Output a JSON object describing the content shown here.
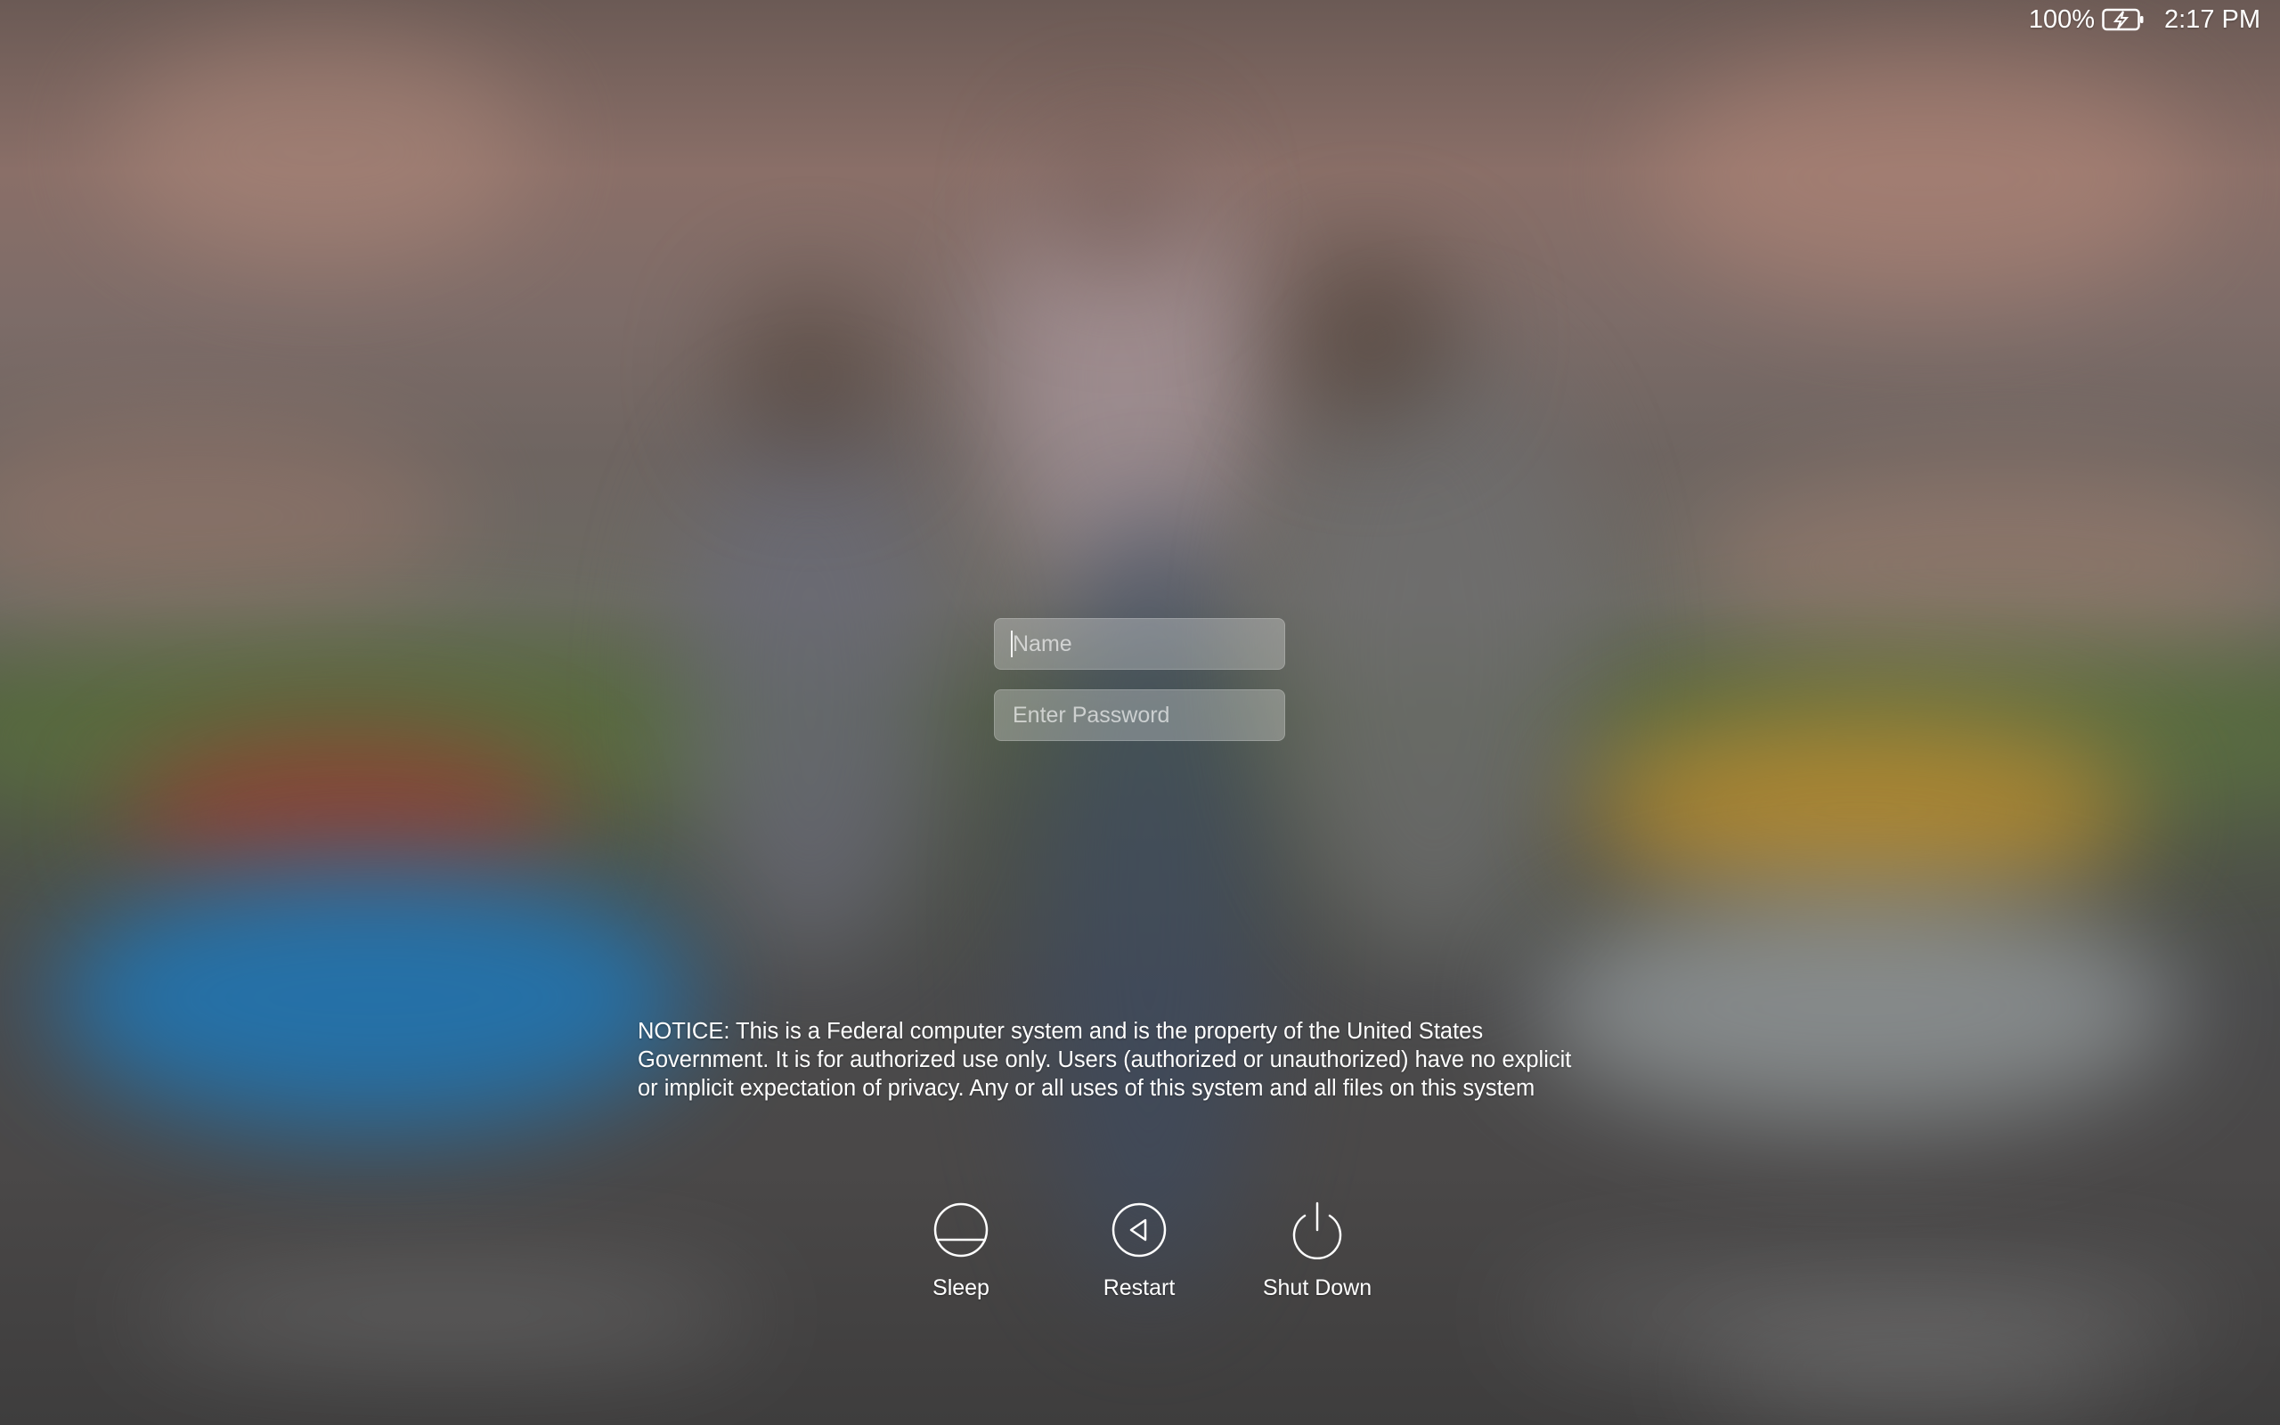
{
  "status_bar": {
    "battery_percent": "100%",
    "battery_icon": "battery-charging-icon",
    "time": "2:17 PM"
  },
  "login": {
    "name_placeholder": "Name",
    "password_placeholder": "Enter Password"
  },
  "notice": {
    "text": "NOTICE: This is a Federal computer system and is the property of the United States\nGovernment. It is for authorized use only. Users (authorized or unauthorized) have no explicit\nor implicit expectation of privacy. Any or all uses of this system and all files on this system"
  },
  "power_actions": {
    "sleep": {
      "label": "Sleep",
      "icon": "sleep-icon"
    },
    "restart": {
      "label": "Restart",
      "icon": "restart-icon"
    },
    "shutdown": {
      "label": "Shut Down",
      "icon": "power-icon"
    }
  },
  "colors": {
    "text": "#ffffff",
    "field_bg": "rgba(255,255,255,0.28)"
  }
}
